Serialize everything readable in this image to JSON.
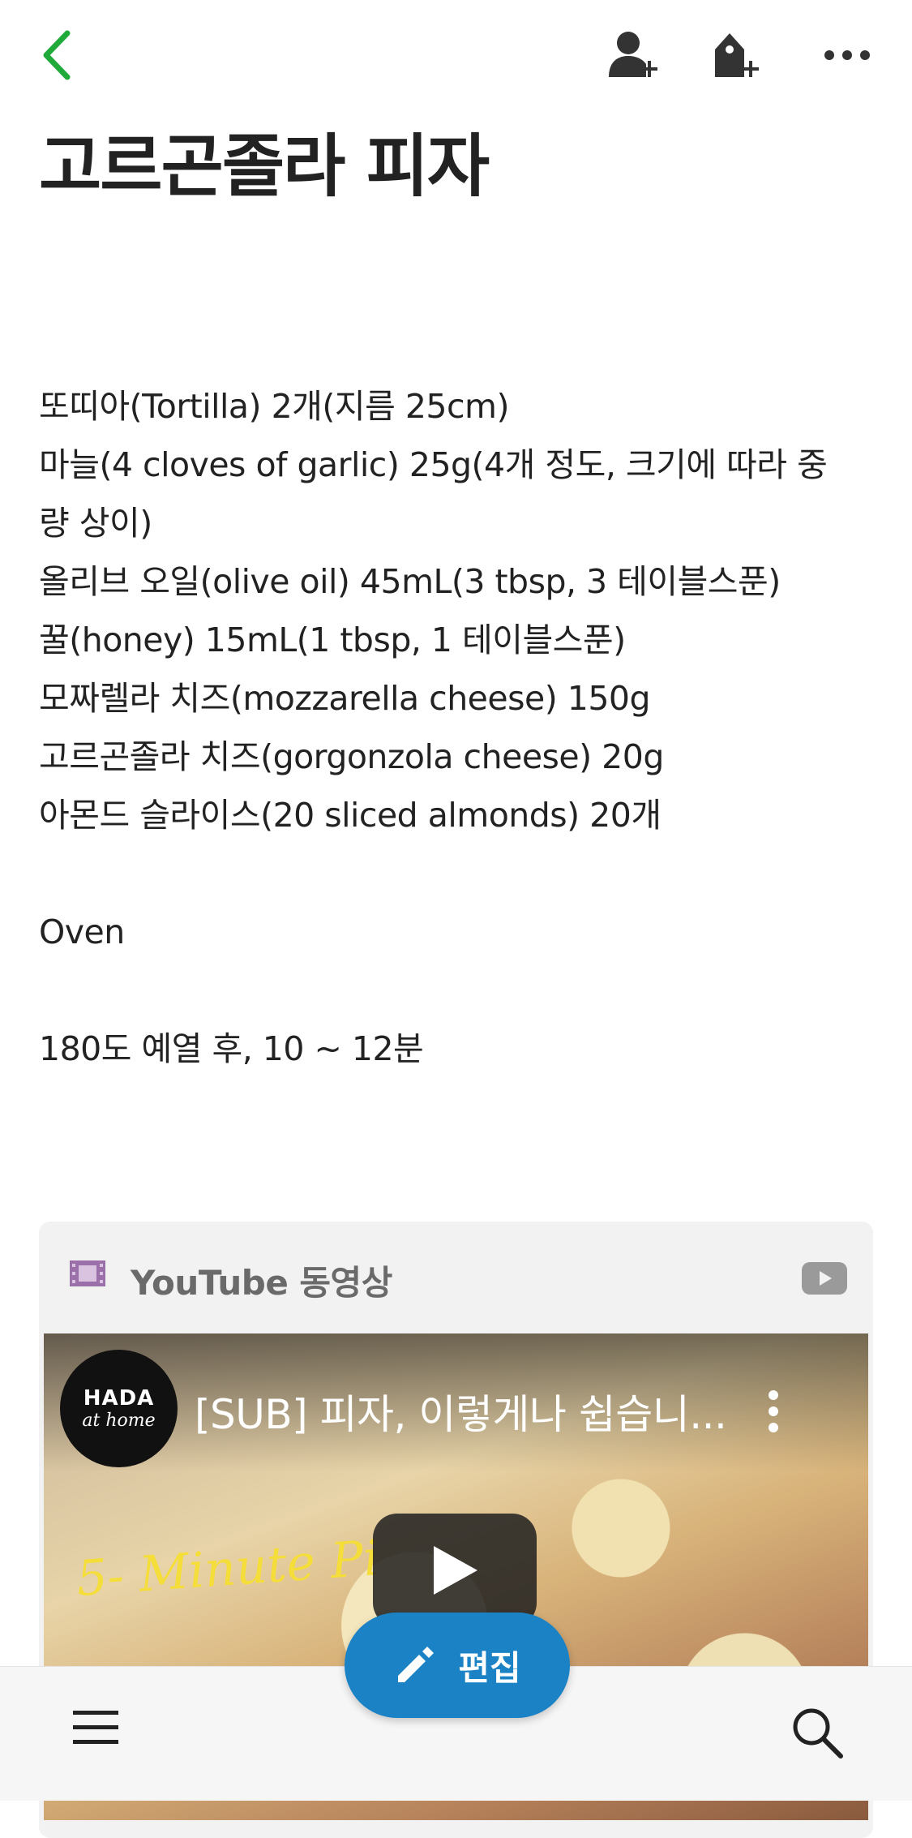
{
  "note": {
    "title": "고르곤졸라 피자",
    "lines": [
      "또띠아(Tortilla) 2개(지름 25cm)",
      "마늘(4 cloves of garlic) 25g(4개 정도, 크기에 따라 중",
      "량 상이)",
      "올리브 오일(olive oil) 45mL(3 tbsp, 3 테이블스푼)",
      "꿀(honey) 15mL(1 tbsp, 1 테이블스푼)",
      "모짜렐라 치즈(mozzarella cheese) 150g",
      "고르곤졸라 치즈(gorgonzola cheese) 20g",
      "아몬드 슬라이스(20 sliced almonds) 20개",
      "",
      "Oven",
      "",
      "180도 예열 후, 10 ~ 12분"
    ]
  },
  "youtube": {
    "label": "YouTube 동영상",
    "video_title": "[SUB] 피자, 이렇게나 쉽습니...",
    "channel_line1": "HADA",
    "channel_line2": "at home",
    "thumbnail_text": "5- Minute Pi"
  },
  "fab": {
    "label": "편집"
  },
  "colors": {
    "accent_green": "#1faa3a",
    "fab_blue": "#1a82c5",
    "film_purple": "#9b6fa8"
  },
  "icons": [
    "back-icon",
    "share-user-icon",
    "add-tag-icon",
    "more-icon",
    "film-icon",
    "youtube-icon",
    "play-icon",
    "pencil-icon",
    "menu-icon",
    "search-icon"
  ]
}
